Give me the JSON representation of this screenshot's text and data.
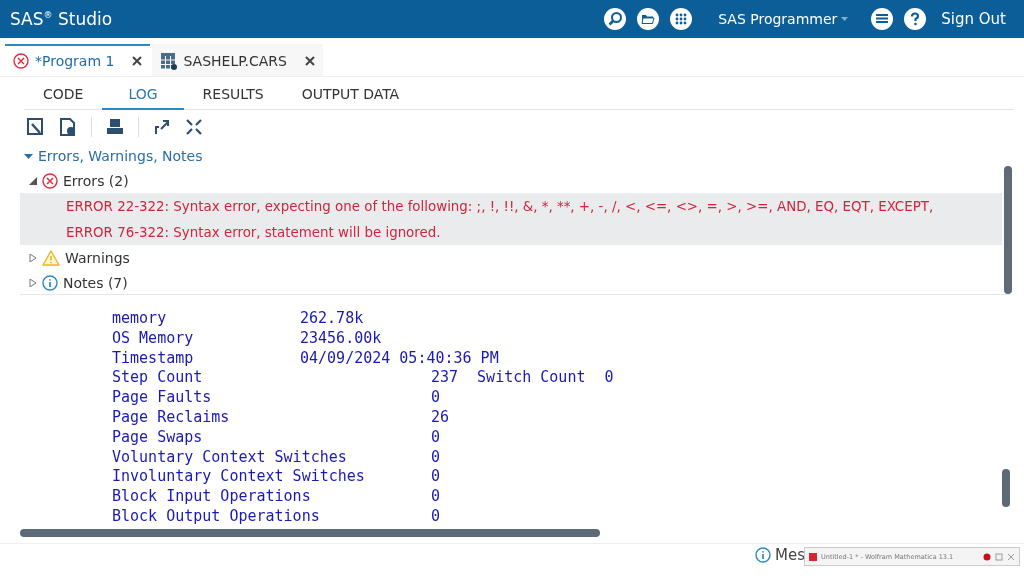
{
  "app_bar": {
    "title": "SAS$^{®}$ Studio",
    "perspective": "SAS Programmer",
    "sign_out": "Sign Out"
  },
  "doc_tabs": [
    {
      "label": "*Program 1",
      "kind": "program",
      "selected": true,
      "error": true
    },
    {
      "label": "SASHELP.CARS",
      "kind": "table",
      "selected": false,
      "error": false
    }
  ],
  "view_tabs": [
    {
      "label": "CODE",
      "selected": false
    },
    {
      "label": "LOG",
      "selected": true
    },
    {
      "label": "RESULTS",
      "selected": false
    },
    {
      "label": "OUTPUT DATA",
      "selected": false
    }
  ],
  "log_tree": {
    "title": "Errors, Warnings, Notes",
    "expanded": true,
    "groups": [
      {
        "label": "Errors (2)",
        "kind": "error",
        "expanded": true,
        "children": [
          {
            "text": "ERROR 22-322: Syntax error, expecting one of the following: ;, !, !!, &, *, **, +, -, /, <, <=, <>, =, >, >=, AND, EQ, EQT, EXCEPT,"
          },
          {
            "text": "ERROR 76-322: Syntax error, statement will be ignored."
          }
        ]
      },
      {
        "label": "Warnings",
        "kind": "warning",
        "expanded": false
      },
      {
        "label": "Notes (7)",
        "kind": "note",
        "expanded": false
      }
    ]
  },
  "log_lines": [
    {
      "label": "memory",
      "kind": "resource",
      "value": "262.78k"
    },
    {
      "label": "OS Memory",
      "kind": "resource",
      "value": "23456.00k"
    },
    {
      "label": "Timestamp",
      "kind": "resource",
      "value": "04/09/2024 05:40:36 PM"
    },
    {
      "label": "Step Count",
      "kind": "count",
      "value": "237",
      "extra_label": "Switch Count",
      "extra_value": "0"
    },
    {
      "label": "Page Faults",
      "kind": "count",
      "value": "0"
    },
    {
      "label": "Page Reclaims",
      "kind": "count",
      "value": "26"
    },
    {
      "label": "Page Swaps",
      "kind": "count",
      "value": "0"
    },
    {
      "label": "Voluntary Context Switches",
      "kind": "count",
      "value": "0"
    },
    {
      "label": "Involuntary Context Switches",
      "kind": "count",
      "value": "0"
    },
    {
      "label": "Block Input Operations",
      "kind": "count",
      "value": "0"
    },
    {
      "label": "Block Output Operations",
      "kind": "count",
      "value": "0"
    }
  ],
  "status_bar": {
    "messages": "Mes"
  },
  "taskbar_preview": {
    "title": "Untitled-1 * - Wolfram Mathematica 13.1"
  }
}
